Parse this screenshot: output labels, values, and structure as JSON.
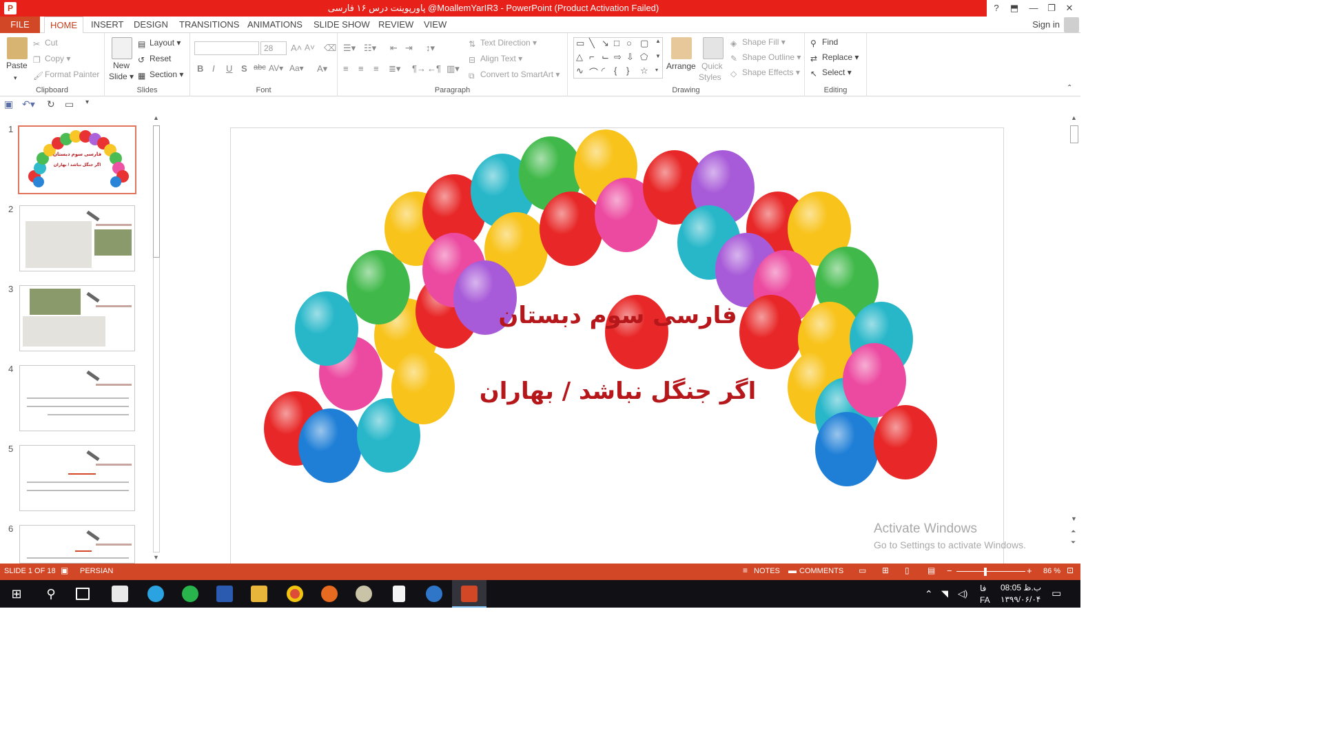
{
  "window": {
    "title": "پاورپوینت  درس ۱۶ فارسی @MoallemYarIR3  -  PowerPoint (Product Activation Failed)",
    "help": "?",
    "ribbon_options": "⬒",
    "minimize": "—",
    "restore": "❐",
    "close": "✕"
  },
  "tabs": {
    "file": "FILE",
    "items": [
      "HOME",
      "INSERT",
      "DESIGN",
      "TRANSITIONS",
      "ANIMATIONS",
      "SLIDE SHOW",
      "REVIEW",
      "VIEW"
    ],
    "signin": "Sign in"
  },
  "ribbon": {
    "clipboard": {
      "label": "Clipboard",
      "paste": "Paste",
      "cut": "Cut",
      "copy": "Copy",
      "format_painter": "Format Painter"
    },
    "slides": {
      "label": "Slides",
      "new_slide": "New",
      "new_slide2": "Slide",
      "layout": "Layout",
      "reset": "Reset",
      "section": "Section"
    },
    "font": {
      "label": "Font",
      "font_name": "",
      "font_size": "28"
    },
    "paragraph": {
      "label": "Paragraph",
      "text_direction": "Text Direction",
      "align_text": "Align Text",
      "convert_smartart": "Convert to SmartArt"
    },
    "drawing": {
      "label": "Drawing",
      "arrange": "Arrange",
      "quick_styles": "Quick",
      "quick_styles2": "Styles",
      "shape_fill": "Shape Fill",
      "shape_outline": "Shape Outline",
      "shape_effects": "Shape Effects"
    },
    "editing": {
      "label": "Editing",
      "find": "Find",
      "replace": "Replace",
      "select": "Select"
    }
  },
  "thumbnails": [
    {
      "num": "1",
      "title": "فارسی سوم دبستان",
      "subtitle": "اگر جنگل نباشد / بهاران"
    },
    {
      "num": "2"
    },
    {
      "num": "3"
    },
    {
      "num": "4"
    },
    {
      "num": "5"
    },
    {
      "num": "6"
    }
  ],
  "slide": {
    "title": "فارسی سوم دبستان",
    "subtitle": "اگر جنگل نباشد / بهاران"
  },
  "watermark": {
    "line1": "Activate Windows",
    "line2": "Go to Settings to activate Windows."
  },
  "status": {
    "slide_info": "SLIDE 1 OF 18",
    "language": "PERSIAN",
    "notes": "NOTES",
    "comments": "COMMENTS",
    "zoom": "86 %"
  },
  "taskbar": {
    "lang_short": "فا",
    "lang": "FA",
    "time": "ب.ظ 08:05",
    "date": "۱۳۹۹/۰۶/۰۴"
  },
  "colors": {
    "accent": "#d24726",
    "titlebar": "#e8201a",
    "slide_text": "#b5171b"
  }
}
